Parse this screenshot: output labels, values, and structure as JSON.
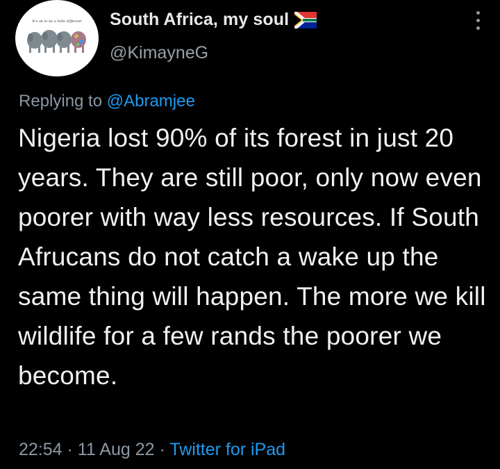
{
  "account": {
    "display_name": "South Africa, my soul",
    "handle": "@KimayneG",
    "avatar_caption": "It's ok to be a little different",
    "flag_icon": "south-africa-flag-icon"
  },
  "reply": {
    "prefix": "Replying to ",
    "mention": "@Abramjee"
  },
  "tweet": {
    "text": "Nigeria lost 90% of its forest in just 20 years. They are still poor, only now even poorer with way less resources. If South Afrucans do not catch a wake up the same thing will happen. The more we kill wildlife for a few rands the poorer we become."
  },
  "meta": {
    "time": "22:54",
    "date": "11 Aug 22",
    "separator": " · ",
    "source": "Twitter for iPad"
  },
  "colors": {
    "background": "#000000",
    "text": "#e7e9ea",
    "secondary": "#8b98a5",
    "link": "#1d9bf0"
  }
}
